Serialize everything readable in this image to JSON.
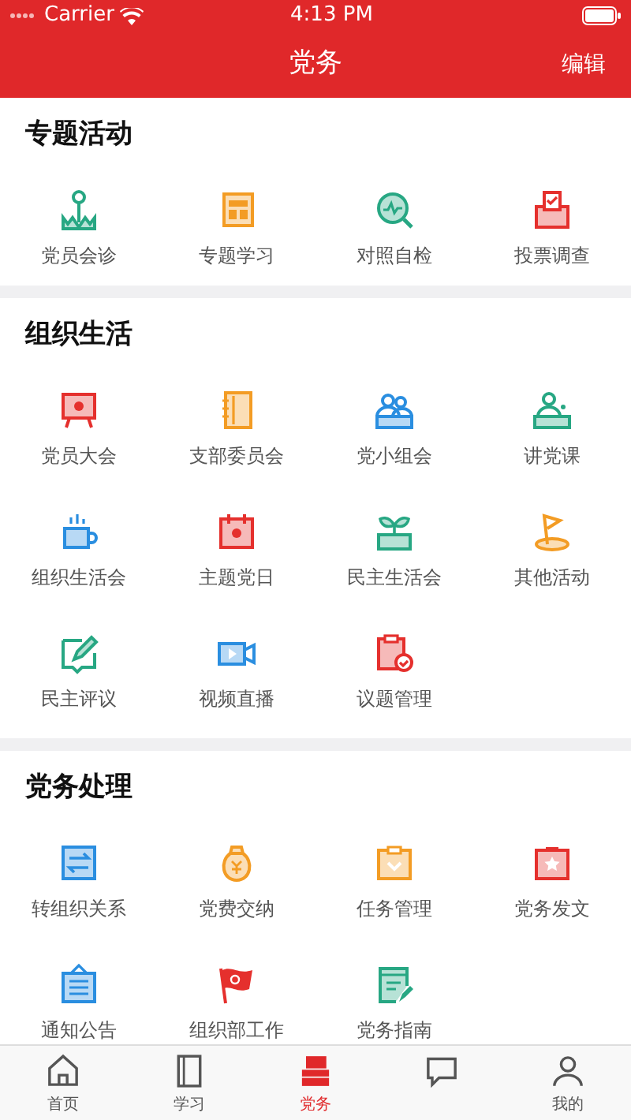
{
  "status_bar": {
    "carrier": "Carrier",
    "time": "4:13 PM"
  },
  "nav_bar": {
    "title": "党务",
    "action": "编辑"
  },
  "sections": [
    {
      "title": "专题活动",
      "items": [
        "党员会诊",
        "专题学习",
        "对照自检",
        "投票调查"
      ]
    },
    {
      "title": "组织生活",
      "items": [
        "党员大会",
        "支部委员会",
        "党小组会",
        "讲党课",
        "组织生活会",
        "主题党日",
        "民主生活会",
        "其他活动",
        "民主评议",
        "视频直播",
        "议题管理"
      ]
    },
    {
      "title": "党务处理",
      "items": [
        "转组织关系",
        "党费交纳",
        "任务管理",
        "党务发文",
        "通知公告",
        "组织部工作",
        "党务指南"
      ]
    }
  ],
  "tab_bar": [
    {
      "label": "首页",
      "selected": false
    },
    {
      "label": "学习",
      "selected": false
    },
    {
      "label": "党务",
      "selected": true
    },
    {
      "selected": false
    },
    {
      "label": "我的",
      "selected": false
    }
  ]
}
